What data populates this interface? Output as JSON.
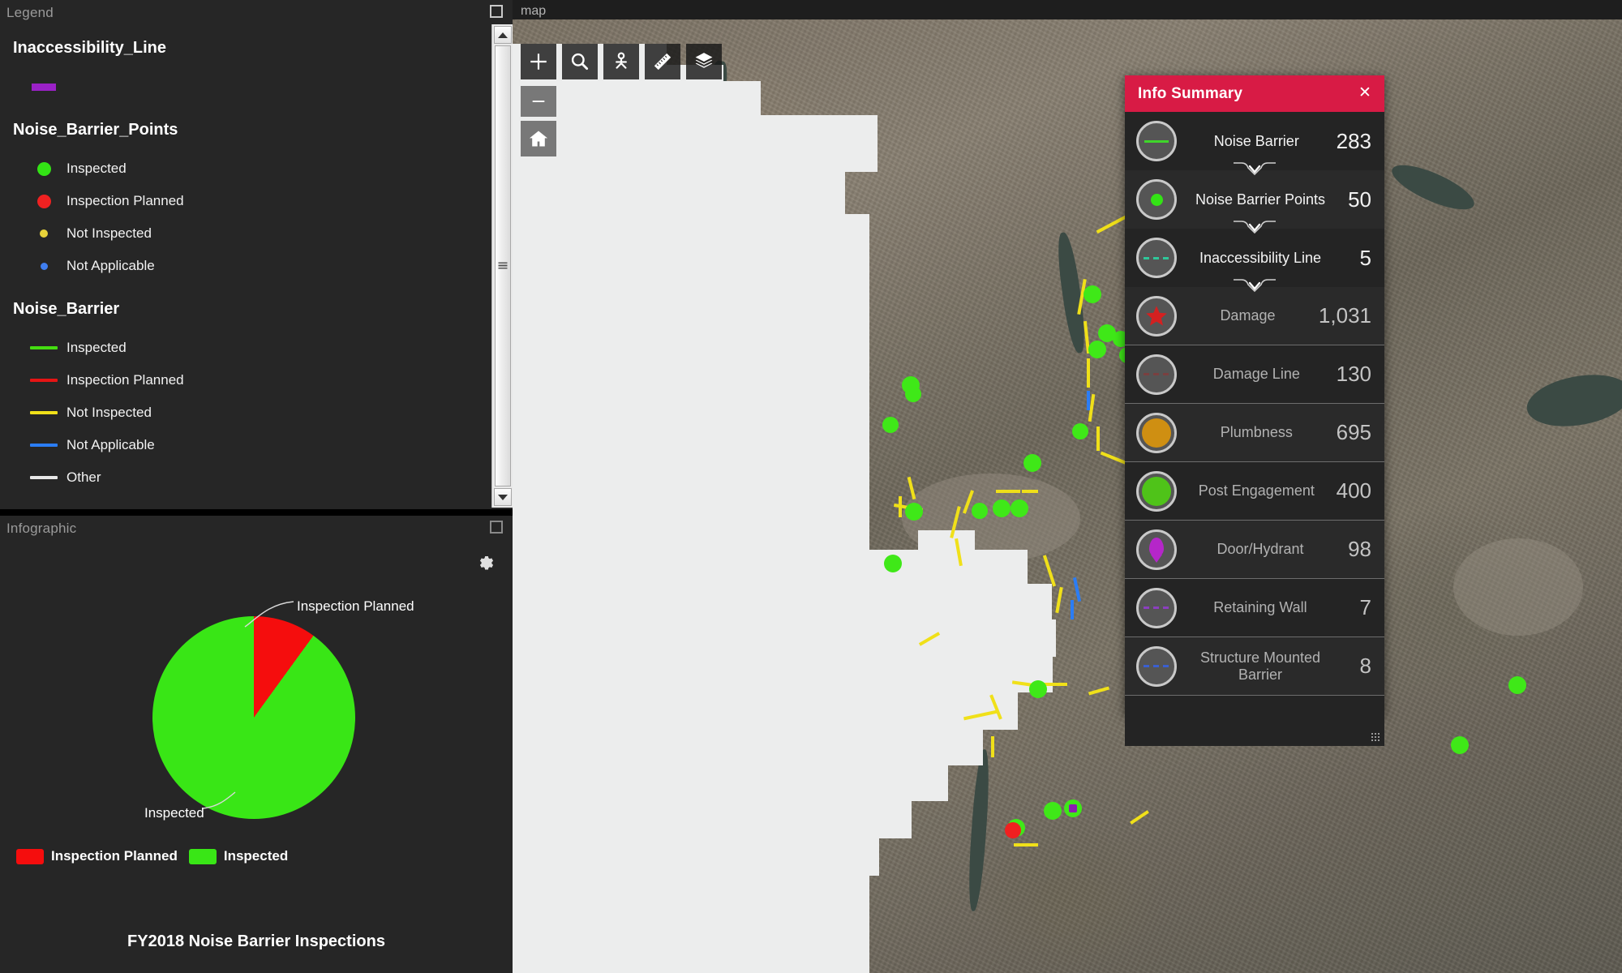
{
  "legend": {
    "panel_title": "Legend",
    "restore_icon": "restore-window-icon",
    "groups": [
      {
        "title": "Inaccessibility_Line",
        "items": [
          {
            "label": "",
            "symbol": "rect",
            "color": "#9b21c7"
          }
        ]
      },
      {
        "title": "Noise_Barrier_Points",
        "items": [
          {
            "label": "Inspected",
            "symbol": "dot",
            "color": "#33e315",
            "size": 17
          },
          {
            "label": "Inspection Planned",
            "symbol": "dot",
            "color": "#ef2121",
            "size": 17
          },
          {
            "label": "Not Inspected",
            "symbol": "dot",
            "color": "#e8d33a",
            "size": 10
          },
          {
            "label": "Not Applicable",
            "symbol": "dot",
            "color": "#3f7ef0",
            "size": 9
          }
        ]
      },
      {
        "title": "Noise_Barrier",
        "items": [
          {
            "label": "Inspected",
            "symbol": "line",
            "color": "#44dd11"
          },
          {
            "label": "Inspection Planned",
            "symbol": "line",
            "color": "#e61414"
          },
          {
            "label": "Not Inspected",
            "symbol": "line",
            "color": "#f0e019"
          },
          {
            "label": "Not Applicable",
            "symbol": "line",
            "color": "#2b7df5"
          },
          {
            "label": "Other",
            "symbol": "line",
            "color": "#e8e8e8"
          }
        ]
      }
    ],
    "scrollbar": {
      "up_icon": "scroll-up-arrow-icon",
      "down_icon": "scroll-down-arrow-icon",
      "thumb_icon": "scrollbar-thumb-grip"
    }
  },
  "infographic": {
    "panel_title": "Infographic",
    "restore_icon": "restore-window-icon",
    "settings_icon": "gear-icon",
    "chart_title": "FY2018 Noise Barrier Inspections",
    "callout_planned": "Inspection Planned",
    "callout_inspected": "Inspected",
    "legend": [
      {
        "label": "Inspection Planned",
        "color": "#f50d0d"
      },
      {
        "label": "Inspected",
        "color": "#39e616"
      }
    ]
  },
  "chart_data": {
    "type": "pie",
    "title": "FY2018 Noise Barrier Inspections",
    "labels": [
      "Inspection Planned",
      "Inspected"
    ],
    "values": [
      10,
      90
    ],
    "colors": [
      "#f50d0d",
      "#39e616"
    ],
    "annotations": [
      "Inspection Planned",
      "Inspected"
    ],
    "legend_position": "bottom-left",
    "start_angle_deg": 0,
    "direction": "clockwise"
  },
  "map": {
    "title": "map",
    "toolbar": [
      {
        "name": "zoom-in-tool",
        "icon": "plus-icon"
      },
      {
        "name": "search-tool",
        "icon": "search-icon"
      },
      {
        "name": "locate-tool",
        "icon": "location-person-icon"
      },
      {
        "name": "measure-tool",
        "icon": "ruler-icon"
      },
      {
        "name": "layers-tool",
        "icon": "layers-stack-icon"
      }
    ],
    "zoom_out": {
      "name": "zoom-out-button",
      "icon": "minus-icon"
    },
    "home": {
      "name": "home-button",
      "icon": "home-icon"
    }
  },
  "summary": {
    "title": "Info Summary",
    "close_icon": "close-icon",
    "rows": [
      {
        "label": "Noise Barrier",
        "value": "283",
        "icon": "line-symbol-icon",
        "color": "#3fd62a",
        "style": "line",
        "expandable": true
      },
      {
        "label": "Noise Barrier Points",
        "value": "50",
        "icon": "point-symbol-icon",
        "color": "#33e315",
        "style": "dot",
        "expandable": true
      },
      {
        "label": "Inaccessibility Line",
        "value": "5",
        "icon": "dashed-line-symbol-icon",
        "color": "#2fc79a",
        "style": "dashed",
        "expandable": true
      },
      {
        "label": "Damage",
        "value": "1,031",
        "icon": "star-symbol-icon",
        "color": "#d42020",
        "style": "star",
        "expandable": false
      },
      {
        "label": "Damage Line",
        "value": "130",
        "icon": "dashed-line-symbol-icon",
        "color": "#7a4040",
        "style": "dashed",
        "expandable": false
      },
      {
        "label": "Plumbness",
        "value": "695",
        "icon": "filled-circle-symbol-icon",
        "color": "#cf8f12",
        "style": "fill",
        "expandable": false
      },
      {
        "label": "Post Engagement",
        "value": "400",
        "icon": "filled-circle-symbol-icon",
        "color": "#4fc319",
        "style": "fill",
        "expandable": false
      },
      {
        "label": "Door/Hydrant",
        "value": "98",
        "icon": "pin-symbol-icon",
        "color": "#b526c9",
        "style": "pin",
        "expandable": false
      },
      {
        "label": "Retaining Wall",
        "value": "7",
        "icon": "dashed-line-symbol-icon",
        "color": "#8b3fbf",
        "style": "dashed",
        "expandable": false
      },
      {
        "label": "Structure Mounted Barrier",
        "value": "8",
        "icon": "dashed-line-symbol-icon",
        "color": "#3a5fd0",
        "style": "dashed",
        "expandable": false
      }
    ],
    "resize_grip_icon": "resize-grip-icon",
    "accent_color": "#d81b45"
  }
}
